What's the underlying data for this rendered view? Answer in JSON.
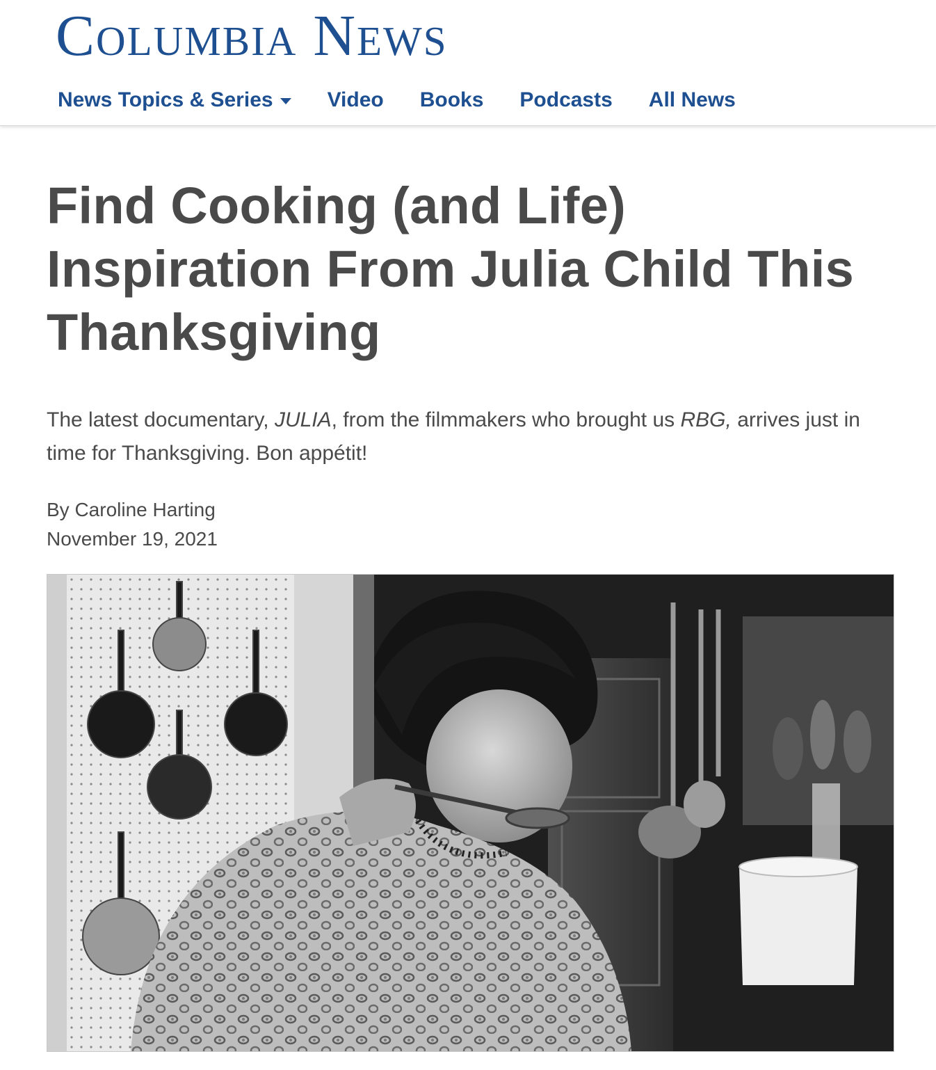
{
  "site": {
    "logo_text": "Columbia News",
    "brand_color": "#1d4f91"
  },
  "nav": {
    "items": [
      {
        "label": "News Topics & Series",
        "has_dropdown": true
      },
      {
        "label": "Video"
      },
      {
        "label": "Books"
      },
      {
        "label": "Podcasts"
      },
      {
        "label": "All News"
      }
    ]
  },
  "article": {
    "headline": "Find Cooking (and Life) Inspiration From Julia Child This Thanksgiving",
    "dek": {
      "part1": "The latest documentary, ",
      "title1": "JULIA",
      "part2": ", from the filmmakers who brought us ",
      "title2": "RBG,",
      "part3": " arrives just in time for Thanksgiving. Bon appétit!"
    },
    "byline": "By Caroline Harting",
    "date": "November 19, 2021",
    "hero_image_subject": "black-and-white photo of Julia Child tasting from a spoon in her kitchen"
  }
}
